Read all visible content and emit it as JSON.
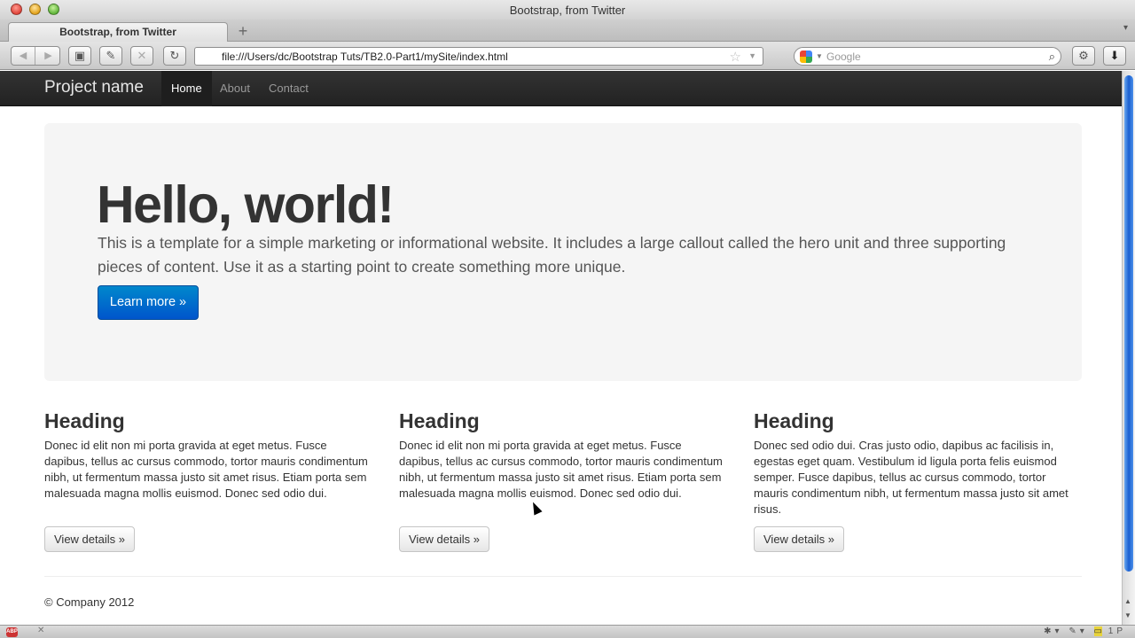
{
  "window": {
    "title": "Bootstrap, from Twitter",
    "new_tab_label": "+"
  },
  "tabs": [
    {
      "label": "Bootstrap, from Twitter",
      "active": true
    }
  ],
  "toolbar": {
    "url": "file:///Users/dc/Bootstrap Tuts/TB2.0-Part1/mySite/index.html",
    "search_placeholder": "Google",
    "back_icon": "back-arrow-icon",
    "forward_icon": "forward-arrow-icon",
    "stop_icon": "stop-icon",
    "reload_icon": "reload-icon"
  },
  "site_nav": {
    "brand": "Project name",
    "links": [
      "Home",
      "About",
      "Contact"
    ],
    "active": "Home"
  },
  "hero": {
    "heading": "Hello, world!",
    "text": "This is a template for a simple marketing or informational website. It includes a large callout called the hero unit and three supporting pieces of content. Use it as a starting point to create something more unique.",
    "button": "Learn more »"
  },
  "columns": [
    {
      "heading": "Heading",
      "text": "Donec id elit non mi porta gravida at eget metus. Fusce dapibus, tellus ac cursus commodo, tortor mauris condimentum nibh, ut fermentum massa justo sit amet risus. Etiam porta sem malesuada magna mollis euismod. Donec sed odio dui.",
      "button": "View details »"
    },
    {
      "heading": "Heading",
      "text": "Donec id elit non mi porta gravida at eget metus. Fusce dapibus, tellus ac cursus commodo, tortor mauris condimentum nibh, ut fermentum massa justo sit amet risus. Etiam porta sem malesuada magna mollis euismod. Donec sed odio dui.",
      "button": "View details »"
    },
    {
      "heading": "Heading",
      "text": "Donec sed odio dui. Cras justo odio, dapibus ac facilisis in, egestas eget quam. Vestibulum id ligula porta felis euismod semper. Fusce dapibus, tellus ac cursus commodo, tortor mauris condimentum nibh, ut fermentum massa justo sit amet risus.",
      "button": "View details »"
    }
  ],
  "footer": {
    "text": "© Company 2012"
  },
  "status_bar": {
    "abp_label": "ABP",
    "right_text": "1P"
  },
  "colors": {
    "navbar": "#222222",
    "hero_bg": "#f5f5f5",
    "primary_button": "#0074cc",
    "text": "#333333"
  }
}
